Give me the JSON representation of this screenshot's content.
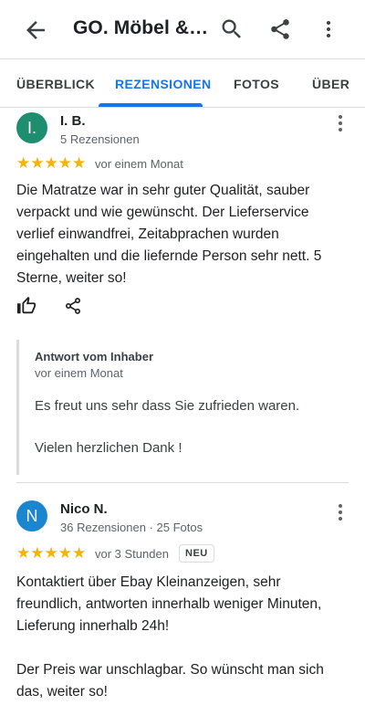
{
  "header": {
    "title": "GO. Möbel & ...",
    "back_icon": "arrow-back-icon",
    "search_icon": "search-icon",
    "share_icon": "share-icon",
    "more_icon": "more-vert-icon"
  },
  "tabs": [
    {
      "label": "ÜBERBLICK",
      "active": false
    },
    {
      "label": "REZENSIONEN",
      "active": true
    },
    {
      "label": "FOTOS",
      "active": false
    },
    {
      "label": "ÜBER",
      "active": false
    }
  ],
  "colors": {
    "accent": "#1a73e8",
    "star": "#f5b400",
    "avatar_ib": "#1e8e6e",
    "avatar_nico": "#1a86d0"
  },
  "reviews": [
    {
      "avatar_letter": "I.",
      "name": "I. B.",
      "meta": "5 Rezensionen",
      "stars": "★★★★★",
      "rating": 5,
      "time": "vor einem Monat",
      "text": "Die Matratze war in sehr guter Qualität, sauber verpackt und wie gewünscht. Der Lieferservice verlief einwandfrei, Zeitabprachen wurden eingehalten und die liefernde Person sehr nett. 5 Sterne, weiter so!",
      "owner_reply": {
        "title": "Antwort vom Inhaber",
        "time": "vor einem Monat",
        "line1": "Es freut uns sehr dass Sie zufrieden waren.",
        "line2": "Vielen herzlichen Dank !"
      }
    },
    {
      "avatar_letter": "N",
      "name": "Nico N.",
      "meta": "36 Rezensionen · 25 Fotos",
      "stars": "★★★★★",
      "rating": 5,
      "time": "vor 3 Stunden",
      "badge": "NEU",
      "text": "Kontaktiert über Ebay Kleinanzeigen, sehr freundlich, antworten innerhalb weniger Minuten, Lieferung innerhalb 24h!\n\nDer Preis war unschlagbar. So wünscht man sich das, weiter so!"
    }
  ]
}
